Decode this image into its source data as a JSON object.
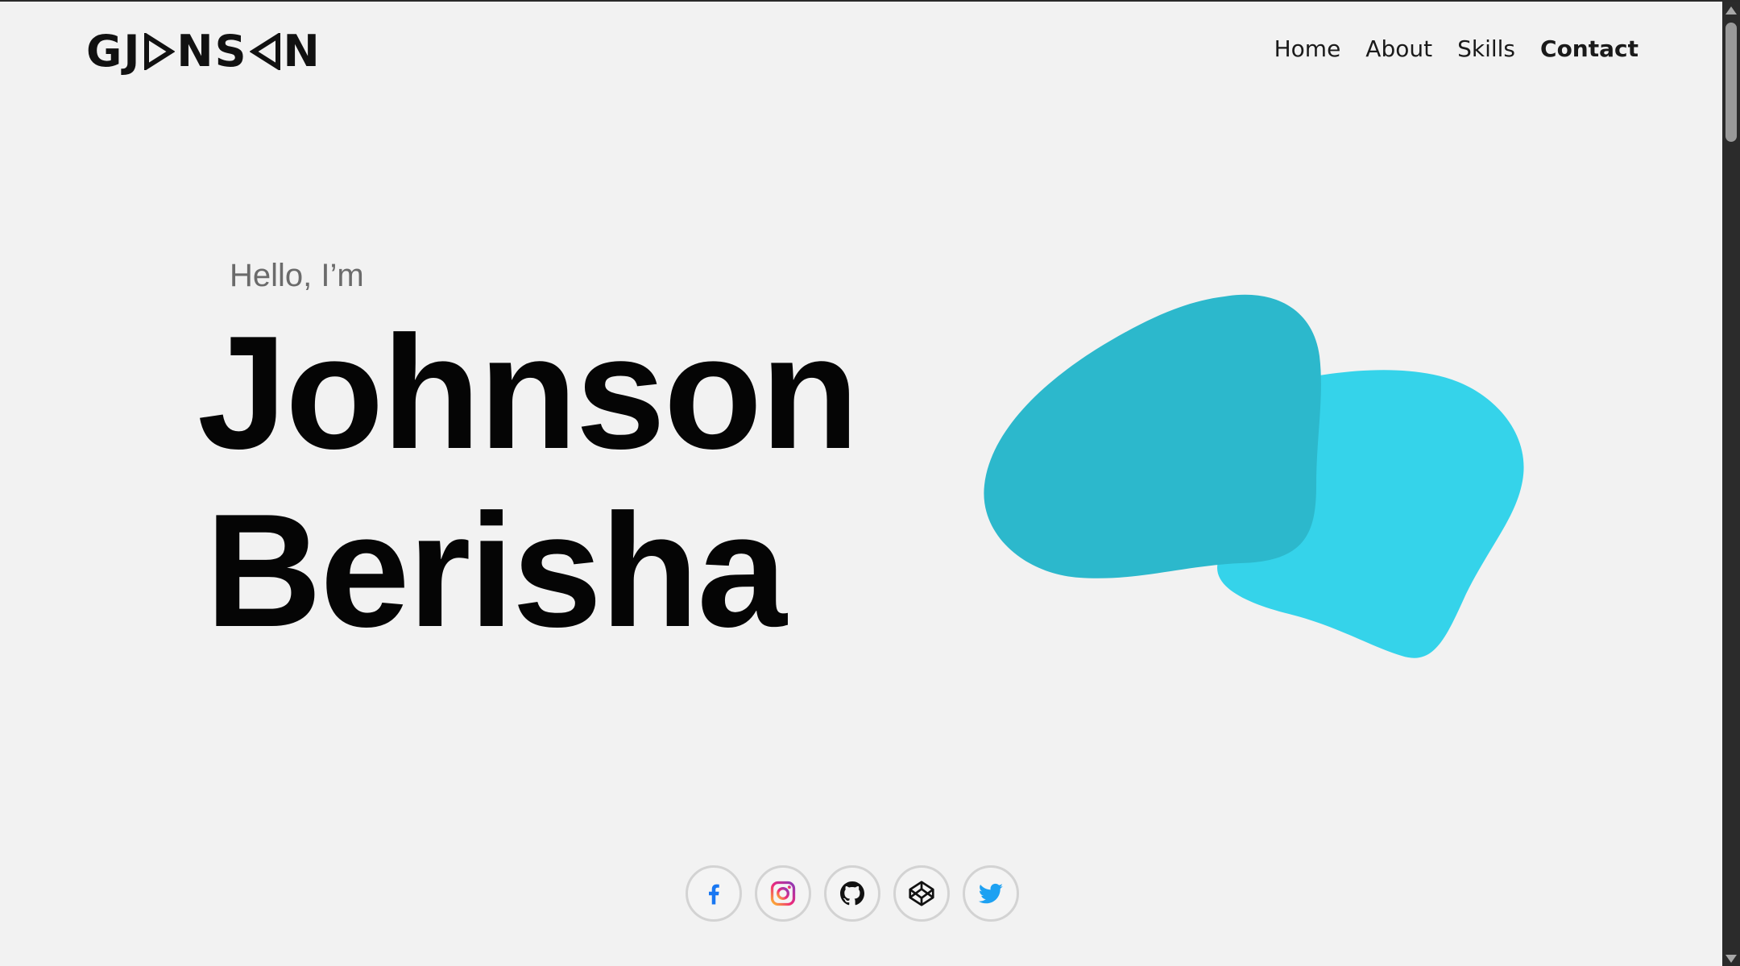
{
  "header": {
    "logo_text": "GJ▷NS◁N",
    "logo_parts": [
      "GJ",
      "NS",
      "N"
    ],
    "nav": [
      {
        "label": "Home",
        "active": false
      },
      {
        "label": "About",
        "active": false
      },
      {
        "label": "Skills",
        "active": false
      },
      {
        "label": "Contact",
        "active": true
      }
    ]
  },
  "hero": {
    "greeting": "Hello, I’m",
    "first_name": "Johnson",
    "last_name": "Berisha",
    "blob_colors": {
      "back": "#35d3ea",
      "front": "#2cb8cc"
    }
  },
  "social": [
    {
      "icon": "facebook-icon",
      "color": "#1877f2"
    },
    {
      "icon": "instagram-icon",
      "color": "#e1306c"
    },
    {
      "icon": "github-icon",
      "color": "#111111"
    },
    {
      "icon": "codepen-icon",
      "color": "#111111"
    },
    {
      "icon": "twitter-icon",
      "color": "#1da1f2"
    }
  ]
}
